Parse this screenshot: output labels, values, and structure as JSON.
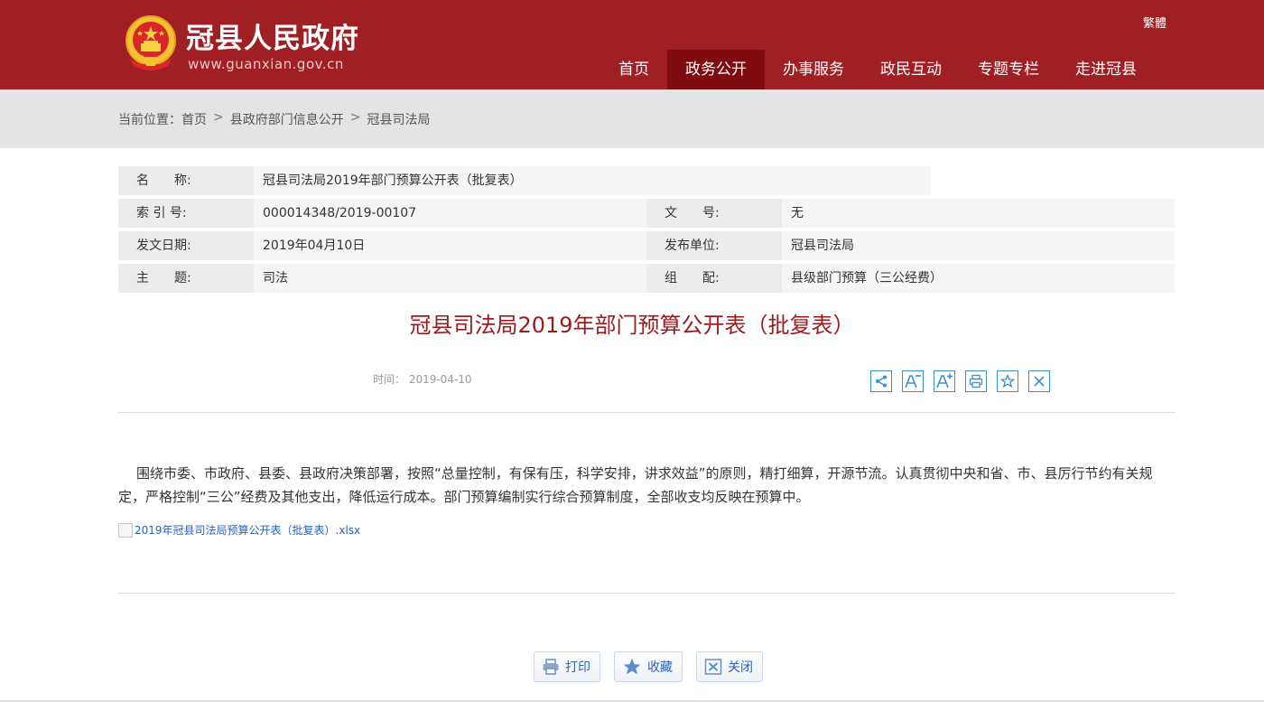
{
  "header": {
    "site_title": "冠县人民政府",
    "site_domain": "www.guanxian.gov.cn",
    "lang_link": "繁體",
    "nav": [
      {
        "label": "首页",
        "active": false
      },
      {
        "label": "政务公开",
        "active": true
      },
      {
        "label": "办事服务",
        "active": false
      },
      {
        "label": "政民互动",
        "active": false
      },
      {
        "label": "专题专栏",
        "active": false
      },
      {
        "label": "走进冠县",
        "active": false
      }
    ]
  },
  "breadcrumb": {
    "prefix": "当前位置：",
    "items": [
      "首页",
      "县政府部门信息公开",
      "冠县司法局"
    ],
    "separator": ">"
  },
  "meta": {
    "name_label": "名　　称:",
    "name_value": "冠县司法局2019年部门预算公开表（批复表）",
    "index_label": "索 引 号:",
    "index_value": "000014348/2019-00107",
    "docno_label": "文　　号:",
    "docno_value": "无",
    "date_label": "发文日期:",
    "date_value": "2019年04月10日",
    "publisher_label": "发布单位:",
    "publisher_value": "冠县司法局",
    "topic_label": "主　　题:",
    "topic_value": "司法",
    "category_label": "组　　配:",
    "category_value": "县级部门预算（三公经费）"
  },
  "article": {
    "title": "冠县司法局2019年部门预算公开表（批复表）",
    "time_text": "时间： 2019-04-10",
    "body": "围绕市委、市政府、县委、县政府决策部署，按照“总量控制，有保有压，科学安排，讲求效益”的原则，精打细算，开源节流。认真贯彻中央和省、市、县厉行节约有关规定，严格控制“三公”经费及其他支出，降低运行成本。部门预算编制实行综合预算制度，全部收支均反映在预算中。",
    "attachment": "2019年冠县司法局预算公开表（批复表）.xlsx"
  },
  "tools": {
    "icons": [
      "share-icon",
      "font-decrease-icon",
      "font-increase-icon",
      "print-icon",
      "favorite-icon",
      "close-icon"
    ],
    "accent_color": "#3a8fcf"
  },
  "actions": {
    "print_label": "打印",
    "favorite_label": "收藏",
    "close_label": "关闭"
  },
  "colors": {
    "header_bg": "#a01f24",
    "nav_active_bg": "#7d0b0f",
    "title_color": "#9b1a1e",
    "link_color": "#2a63b8"
  }
}
